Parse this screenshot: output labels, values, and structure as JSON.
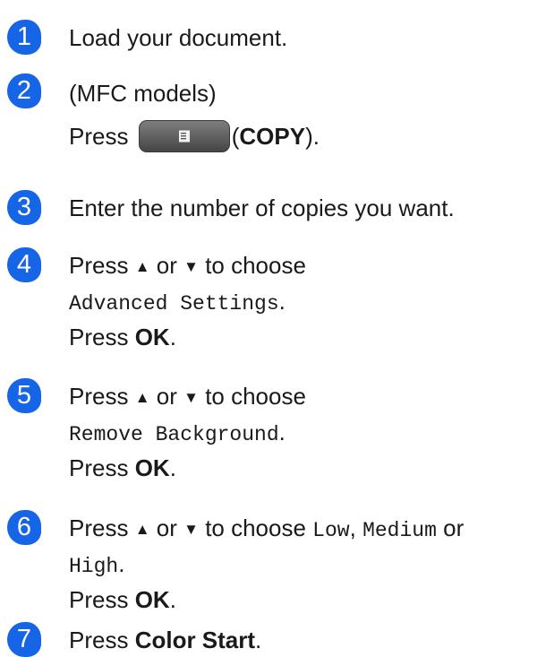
{
  "colors": {
    "badge": "#1565e6",
    "text": "#1a1a1a"
  },
  "steps": [
    {
      "number": "1",
      "text": "Load your document."
    },
    {
      "number": "2",
      "line1": "(MFC models)",
      "press": "Press",
      "button_icon": "copy-icon",
      "copy_open": "(",
      "copy_label": "COPY",
      "copy_close": ")."
    },
    {
      "number": "3",
      "text": "Enter the number of copies you want."
    },
    {
      "number": "4",
      "press": "Press",
      "up": "▲",
      "or": "or",
      "down": "▼",
      "to_choose": "to choose",
      "option": "Advanced Settings",
      "period": ".",
      "press_ok": "Press",
      "ok": "OK",
      "ok_period": "."
    },
    {
      "number": "5",
      "press": "Press",
      "up": "▲",
      "or": "or",
      "down": "▼",
      "to_choose": "to choose",
      "option": "Remove Background",
      "period": ".",
      "press_ok": "Press",
      "ok": "OK",
      "ok_period": "."
    },
    {
      "number": "6",
      "press": "Press",
      "up": "▲",
      "or": "or",
      "down": "▼",
      "to_choose": "to choose",
      "low": "Low",
      "comma": ",",
      "medium": "Medium",
      "or2": "or",
      "high": "High",
      "period": ".",
      "press_ok": "Press",
      "ok": "OK",
      "ok_period": "."
    },
    {
      "number": "7",
      "press": "Press",
      "action": "Color Start",
      "period": "."
    }
  ]
}
